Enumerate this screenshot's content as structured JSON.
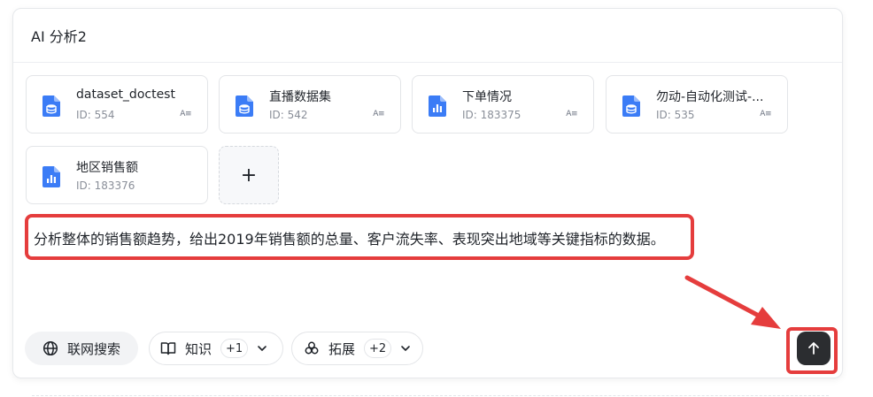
{
  "header": {
    "title": "AI 分析2"
  },
  "datasets": [
    {
      "title": "dataset_doctest",
      "id": "ID: 554",
      "badge": "A≡",
      "icon": "database-doc-icon"
    },
    {
      "title": "直播数据集",
      "id": "ID: 542",
      "badge": "A≡",
      "icon": "database-doc-icon"
    },
    {
      "title": "下单情况",
      "id": "ID: 183375",
      "badge": "A≡",
      "icon": "chart-doc-icon"
    },
    {
      "title": "勿动-自动化测试-...",
      "id": "ID: 535",
      "badge": "A≡",
      "icon": "database-doc-icon"
    },
    {
      "title": "地区销售额",
      "id": "ID: 183376",
      "badge": "",
      "icon": "chart-doc-icon"
    }
  ],
  "add_button": {
    "label": "+"
  },
  "prompt": {
    "text": "分析整体的销售额趋势，给出2019年销售额的总量、客户流失率、表现突出地域等关键指标的数据。"
  },
  "toolbar": {
    "web_search": {
      "label": "联网搜索",
      "icon": "globe-icon"
    },
    "knowledge": {
      "label": "知识",
      "count": "+1",
      "icon": "book-icon"
    },
    "extend": {
      "label": "拓展",
      "count": "+2",
      "icon": "extension-icon"
    }
  },
  "send_button": {
    "icon": "arrow-up-icon"
  },
  "colors": {
    "accent_doc": "#3b7cf6",
    "highlight_red": "#e53d3d",
    "send_bg": "#2b2d30"
  }
}
